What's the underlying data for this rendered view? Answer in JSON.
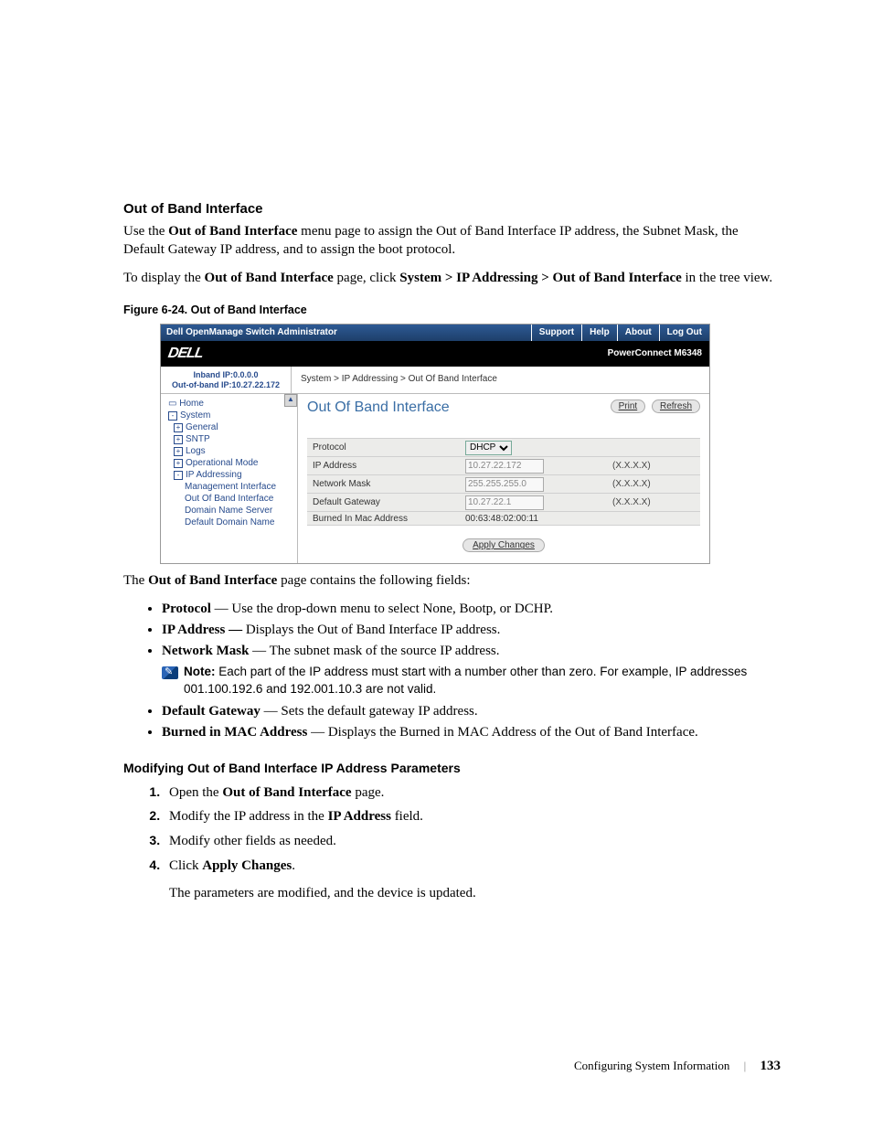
{
  "section": {
    "title": "Out of Band Interface",
    "intro_pre": "Use the ",
    "intro_bold": "Out of Band Interface",
    "intro_post": " menu page to assign the Out of Band Interface IP address, the Subnet Mask, the Default Gateway IP address, and to assign the boot protocol.",
    "nav_pre": "To display the ",
    "nav_bold1": "Out of Band Interface",
    "nav_mid": " page, click ",
    "nav_bold2": "System > IP Addressing > Out of Band Interface",
    "nav_post": " in the tree view."
  },
  "figure": {
    "caption": "Figure 6-24.    Out of Band Interface"
  },
  "screenshot": {
    "topbar": {
      "title": "Dell OpenManage Switch Administrator",
      "links": [
        "Support",
        "Help",
        "About",
        "Log Out"
      ]
    },
    "brand": {
      "logo": "DELL",
      "product": "PowerConnect M6348"
    },
    "ipbar": {
      "inband_label": "Inband IP:",
      "inband_ip": "0.0.0.0",
      "oob_label": "Out-of-band IP:",
      "oob_ip": "10.27.22.172",
      "breadcrumb": "System > IP Addressing > Out Of Band Interface"
    },
    "tree": {
      "items": [
        {
          "level": 0,
          "icon": "home",
          "label": "Home"
        },
        {
          "level": 0,
          "icon": "minus",
          "label": "System"
        },
        {
          "level": 1,
          "icon": "plus",
          "label": "General"
        },
        {
          "level": 1,
          "icon": "plus",
          "label": "SNTP"
        },
        {
          "level": 1,
          "icon": "plus",
          "label": "Logs"
        },
        {
          "level": 1,
          "icon": "plus",
          "label": "Operational Mode"
        },
        {
          "level": 1,
          "icon": "minus",
          "label": "IP Addressing"
        },
        {
          "level": 2,
          "icon": "",
          "label": "Management Interface"
        },
        {
          "level": 2,
          "icon": "",
          "label": "Out Of Band Interface"
        },
        {
          "level": 2,
          "icon": "",
          "label": "Domain Name Server"
        },
        {
          "level": 2,
          "icon": "",
          "label": "Default Domain Name"
        }
      ]
    },
    "content": {
      "heading": "Out Of Band Interface",
      "print": "Print",
      "refresh": "Refresh",
      "rows": {
        "protocol": {
          "label": "Protocol",
          "value": "DHCP",
          "hint": ""
        },
        "ip": {
          "label": "IP Address",
          "value": "10.27.22.172",
          "hint": "(X.X.X.X)"
        },
        "mask": {
          "label": "Network Mask",
          "value": "255.255.255.0",
          "hint": "(X.X.X.X)"
        },
        "gateway": {
          "label": "Default Gateway",
          "value": "10.27.22.1",
          "hint": "(X.X.X.X)"
        },
        "mac": {
          "label": "Burned In Mac Address",
          "value": "00:63:48:02:00:11",
          "hint": ""
        }
      },
      "apply": "Apply Changes"
    }
  },
  "fields_intro_pre": "The ",
  "fields_intro_bold": "Out of Band Interface",
  "fields_intro_post": " page contains the following fields:",
  "fields": {
    "protocol": {
      "name": "Protocol",
      "desc": " — Use the drop-down menu to select None, Bootp, or DCHP."
    },
    "ip": {
      "name": "IP Address —",
      "desc": " Displays the Out of Band Interface IP address."
    },
    "mask": {
      "name": "Network Mask",
      "desc": " — The subnet mask of the source IP address."
    },
    "note": {
      "label": "Note:",
      "text": " Each part of the IP address must start with a number other than zero. For example, IP addresses 001.100.192.6 and 192.001.10.3 are not valid."
    },
    "gateway": {
      "name": "Default Gateway",
      "desc": " — Sets the default gateway IP address."
    },
    "mac": {
      "name": "Burned in MAC Address",
      "desc": " — Displays the Burned in MAC Address of the Out of Band Interface."
    }
  },
  "modify": {
    "heading": "Modifying Out of Band Interface IP Address Parameters",
    "step1_pre": "Open the ",
    "step1_bold": "Out of Band Interface",
    "step1_post": " page.",
    "step2_pre": "Modify the IP address in the ",
    "step2_bold": "IP Address",
    "step2_post": " field.",
    "step3": "Modify other fields as needed.",
    "step4_pre": "Click ",
    "step4_bold": "Apply Changes",
    "step4_post": ".",
    "result": "The parameters are modified, and the device is updated."
  },
  "footer": {
    "chapter": "Configuring System Information",
    "page": "133"
  }
}
